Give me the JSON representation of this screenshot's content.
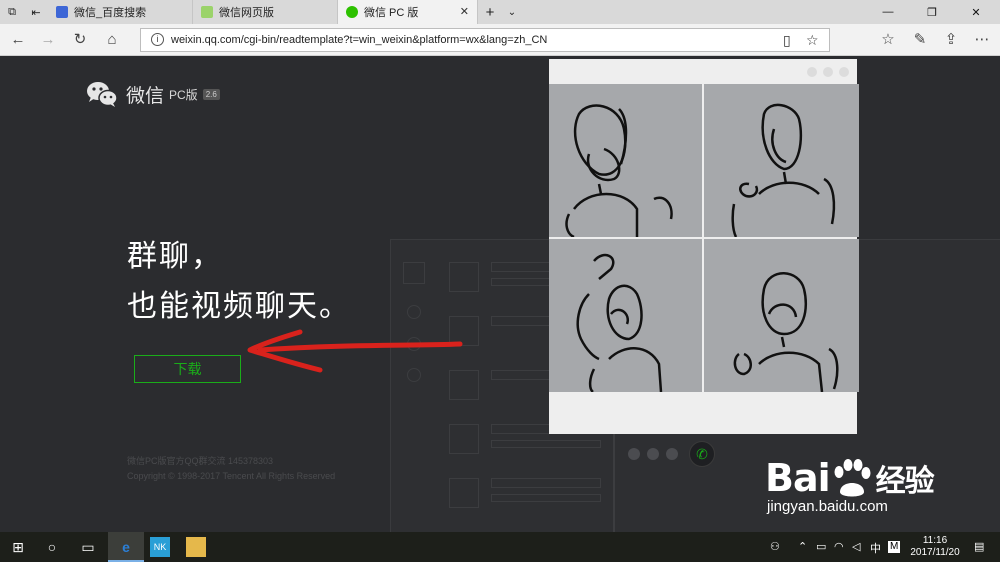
{
  "browser": {
    "tabs": [
      {
        "title": "微信_百度搜索",
        "favicon": "baidu-favicon"
      },
      {
        "title": "微信网页版",
        "favicon": "wechat-web-favicon"
      },
      {
        "title": "微信 PC 版",
        "favicon": "wechat-favicon",
        "active": true
      }
    ],
    "url": "weixin.qq.com/cgi-bin/readtemplate?t=win_weixin&platform=wx&lang=zh_CN"
  },
  "page": {
    "logo_name": "微信",
    "logo_pc": "PC版",
    "logo_version": "2.6",
    "headline_line1": "群聊，",
    "headline_line2": "也能视频聊天。",
    "download_label": "下载",
    "footer_line1": "微信PC版官方QQ群交流 145378303",
    "footer_line2": "Copyright © 1998-2017 Tencent All Rights Reserved"
  },
  "watermark": {
    "brand": "Bai",
    "brand_cn": "经验",
    "domain": "jingyan.baidu.com"
  },
  "taskbar": {
    "clock_time": "11:16",
    "clock_date": "2017/11/20",
    "ime_label": "中",
    "ime_mode": "M"
  },
  "colors": {
    "accent": "#1aad19",
    "background": "#2b2c2f",
    "arrow": "#d9221c"
  }
}
